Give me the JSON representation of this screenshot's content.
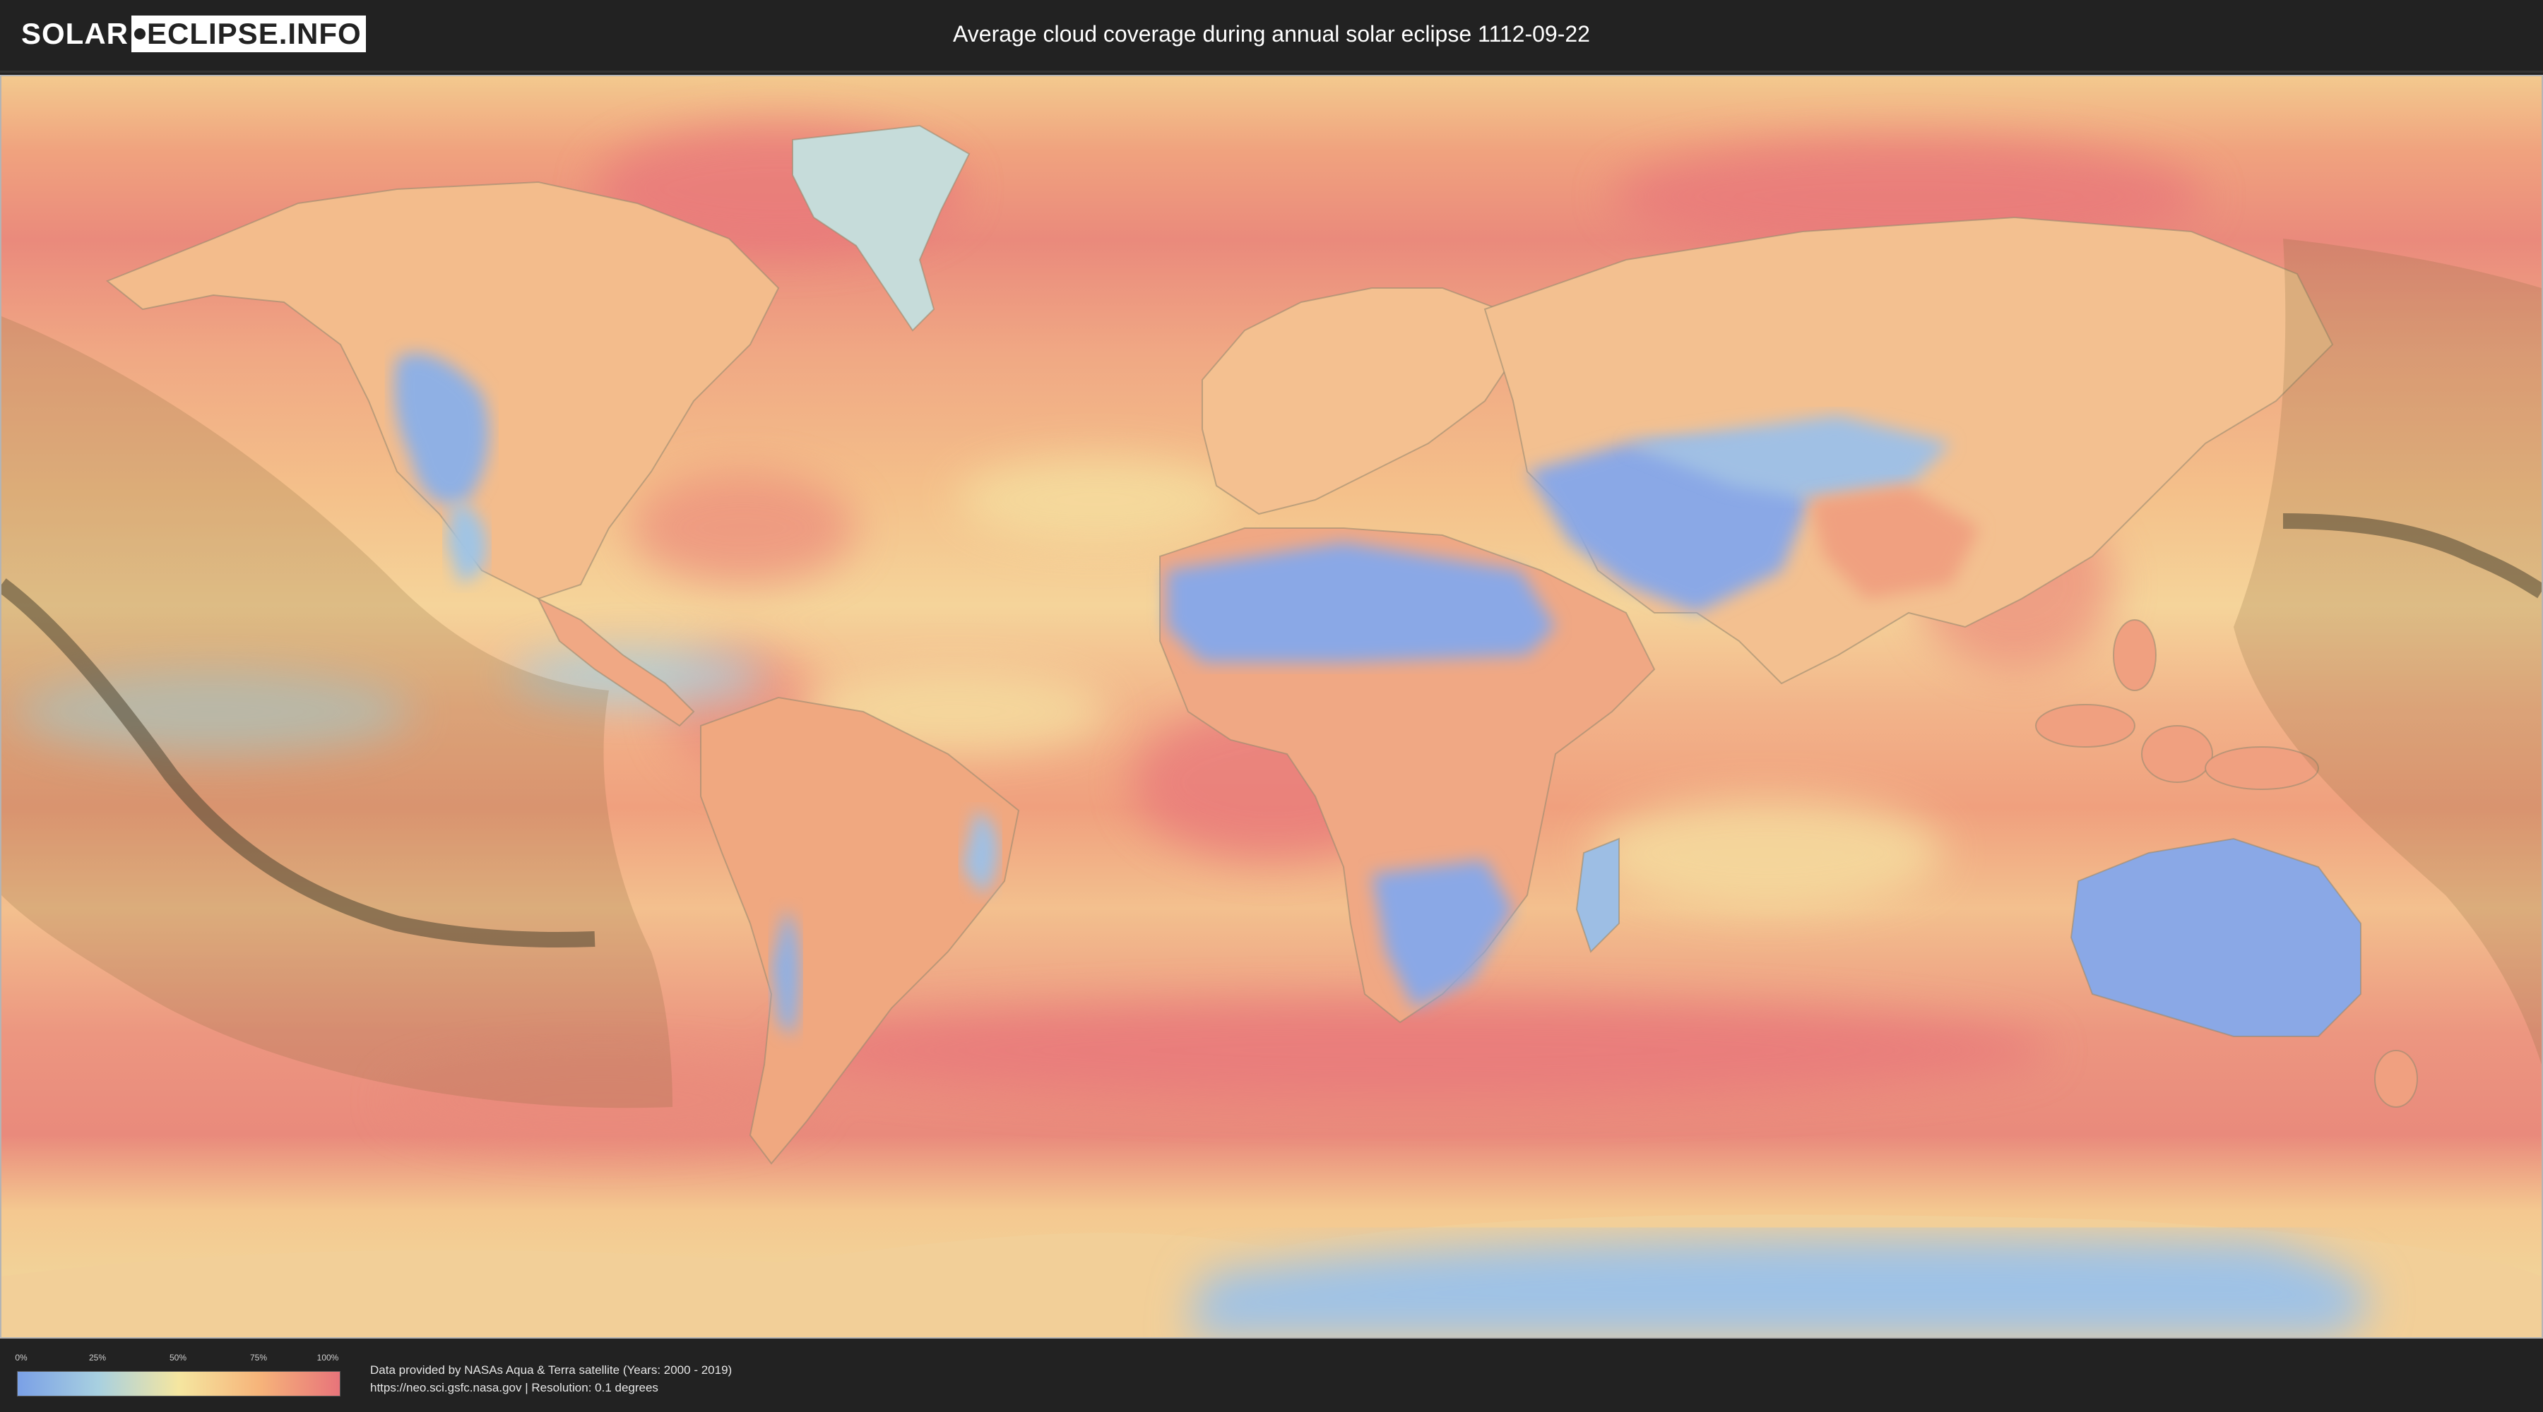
{
  "header": {
    "logo_left": "SOLAR",
    "logo_right": "ECLIPSE.INFO",
    "title": "Average cloud coverage during annual solar eclipse 1112-09-22"
  },
  "legend": {
    "ticks": [
      "0%",
      "25%",
      "50%",
      "75%",
      "100%"
    ],
    "colors": [
      "#7aa0e6",
      "#a8d0e0",
      "#f5e6a0",
      "#f6b47a",
      "#e8747a"
    ]
  },
  "footer": {
    "line1": "Data provided by NASAs Aqua & Terra satellite (Years: 2000 - 2019)",
    "line2": "https://neo.sci.gsfc.nasa.gov | Resolution: 0.1 degrees"
  }
}
